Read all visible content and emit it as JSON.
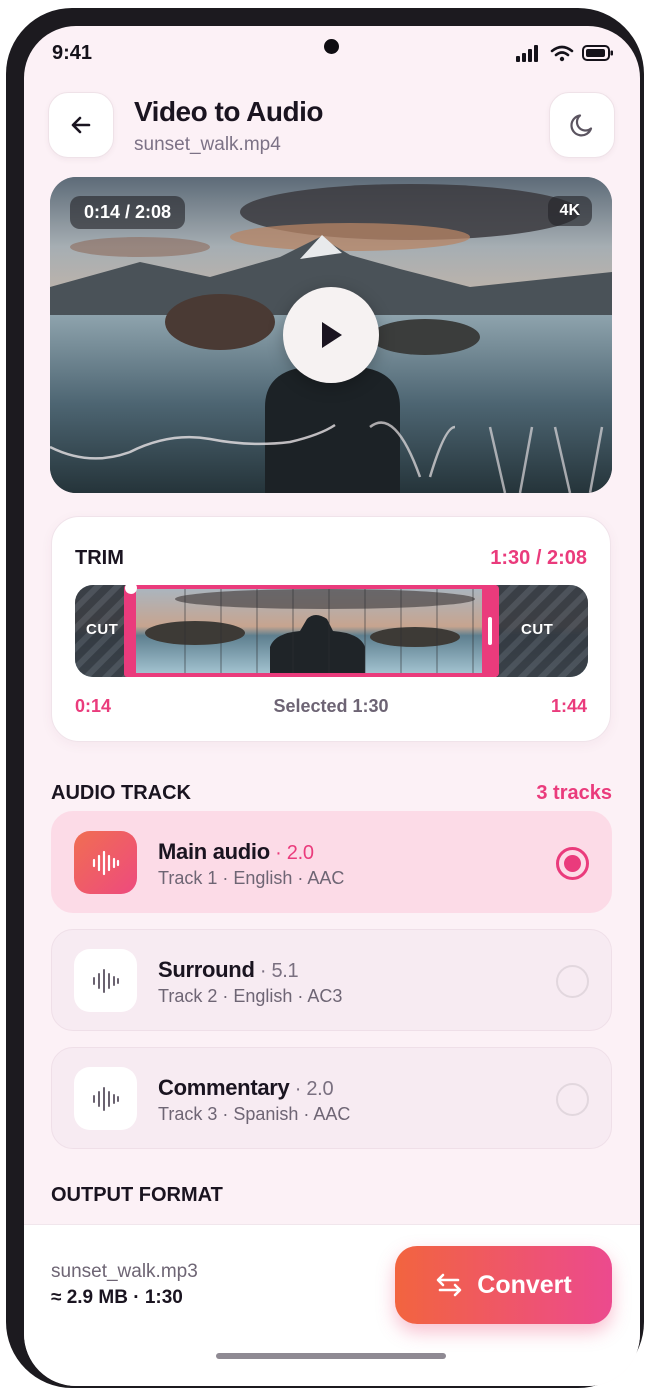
{
  "status_bar": {
    "time": "9:41"
  },
  "header": {
    "title": "Video to Audio",
    "subtitle": "sunset_walk.mp4"
  },
  "video": {
    "timecode": "0:14 / 2:08",
    "quality": "4K"
  },
  "trim": {
    "label": "TRIM",
    "duration": "1:30 / 2:08",
    "start": "0:14",
    "selected": "Selected 1:30",
    "end": "1:44",
    "cut_label": "CUT"
  },
  "audio_track": {
    "label": "AUDIO TRACK",
    "count": "3 tracks",
    "tracks": [
      {
        "name": "Main audio",
        "channels": " · 2.0",
        "meta": "Track 1 · English · AAC",
        "selected": true
      },
      {
        "name": "Surround",
        "channels": " · 5.1",
        "meta": "Track 2 · English · AC3",
        "selected": false
      },
      {
        "name": "Commentary",
        "channels": " · 2.0",
        "meta": "Track 3 · Spanish · AAC",
        "selected": false
      }
    ]
  },
  "output_format": {
    "label": "OUTPUT FORMAT"
  },
  "footer": {
    "file": "sunset_walk.mp3",
    "size": "≈ 2.9 MB · 1:30",
    "convert_label": "Convert"
  },
  "colors": {
    "accent": "#ea3b7c",
    "gradient_start": "#f2643f",
    "gradient_end": "#ec4a8e",
    "background": "#fcf1f6"
  }
}
